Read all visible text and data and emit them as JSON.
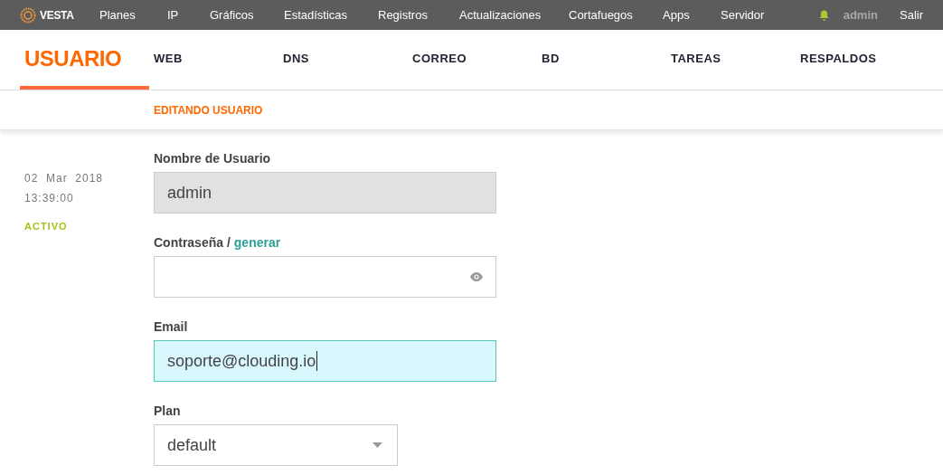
{
  "top_bar": {
    "logo": "VESTA",
    "menu": [
      {
        "label": "Planes"
      },
      {
        "label": "IP"
      },
      {
        "label": "Gráficos"
      },
      {
        "label": "Estadísticas"
      },
      {
        "label": "Registros"
      },
      {
        "label": "Actualizaciones"
      },
      {
        "label": "Cortafuegos"
      },
      {
        "label": "Apps"
      },
      {
        "label": "Servidor"
      }
    ],
    "user": "admin",
    "logout": "Salir"
  },
  "tabs": [
    {
      "label": "USUARIO",
      "selected": true
    },
    {
      "label": "WEB",
      "selected": false
    },
    {
      "label": "DNS",
      "selected": false
    },
    {
      "label": "CORREO",
      "selected": false
    },
    {
      "label": "BD",
      "selected": false
    },
    {
      "label": "TAREAS",
      "selected": false
    },
    {
      "label": "RESPALDOS",
      "selected": false
    }
  ],
  "breadcrumb": "EDITANDO USUARIO",
  "sidebar": {
    "date": "02  Mar  2018",
    "time": "13:39:00",
    "status": "ACTIVO"
  },
  "form": {
    "fields": [
      {
        "kind": "text",
        "label": "Nombre de Usuario",
        "value": "admin",
        "disabled": true,
        "focused": false
      },
      {
        "kind": "password",
        "label": "Contraseña /",
        "link": "generar",
        "disabled": false,
        "focused": false
      },
      {
        "kind": "text",
        "label": "Email",
        "value": "soporte@clouding.io",
        "disabled": false,
        "focused": true
      },
      {
        "kind": "select",
        "label": "Plan",
        "value": "default",
        "disabled": false,
        "focused": false
      }
    ]
  }
}
